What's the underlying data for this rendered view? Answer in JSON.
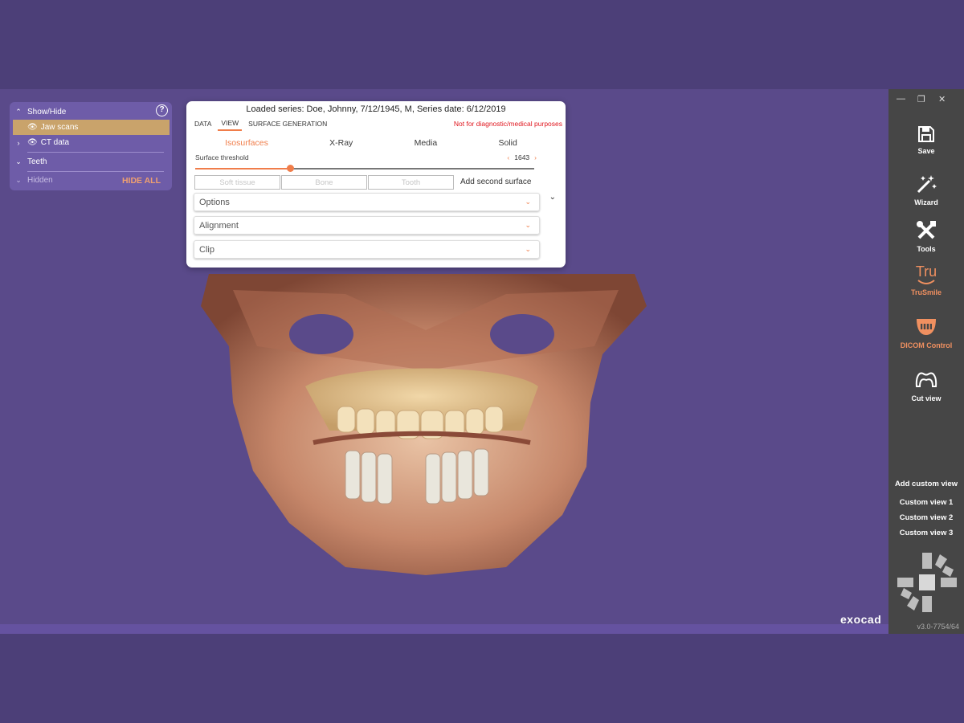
{
  "show_hide": {
    "title": "Show/Hide",
    "help_icon": "?",
    "items": [
      {
        "label": "Jaw scans"
      },
      {
        "label": "CT data"
      },
      {
        "label": "Teeth"
      },
      {
        "label": "Hidden"
      }
    ],
    "hide_all_label": "HIDE ALL"
  },
  "series_panel": {
    "title": "Loaded series: Doe, Johnny, 7/12/1945, M, Series date: 6/12/2019",
    "tabs": [
      {
        "label": "DATA"
      },
      {
        "label": "VIEW"
      },
      {
        "label": "SURFACE GENERATION"
      }
    ],
    "active_tab": "VIEW",
    "warning": "Not for diagnostic/medical purposes",
    "modes": [
      {
        "label": "Isosurfaces"
      },
      {
        "label": "X-Ray"
      },
      {
        "label": "Media"
      },
      {
        "label": "Solid"
      }
    ],
    "active_mode": "Isosurfaces",
    "threshold": {
      "label": "Surface threshold",
      "value": "1643",
      "slider_fraction": 0.28
    },
    "surface_buttons": [
      {
        "label": "Soft tissue"
      },
      {
        "label": "Bone"
      },
      {
        "label": "Tooth"
      }
    ],
    "add_second_label": "Add second surface",
    "sections": [
      {
        "label": "Options"
      },
      {
        "label": "Alignment"
      },
      {
        "label": "Clip"
      }
    ]
  },
  "toolbar": {
    "tools": [
      {
        "label": "Save",
        "icon": "save-icon"
      },
      {
        "label": "Wizard",
        "icon": "wizard-icon"
      },
      {
        "label": "Tools",
        "icon": "tools-icon"
      },
      {
        "label": "TruSmile",
        "icon": "trusmile-icon"
      },
      {
        "label": "DICOM Control",
        "icon": "dicom-icon"
      },
      {
        "label": "Cut view",
        "icon": "cut-view-icon"
      }
    ],
    "trusmile_icon_text": "Tru",
    "add_custom_view": "Add custom view",
    "custom_views": [
      "Custom view 1",
      "Custom view 2",
      "Custom view 3"
    ],
    "version": "v3.0-7754/64"
  },
  "logo": "exocad",
  "colors": {
    "accent": "#f07d4a",
    "background": "#4c3f78",
    "panel": "#6e5ca8",
    "selected_row": "#c9a36b",
    "toolbar": "#464646",
    "warning": "#e0161e"
  }
}
